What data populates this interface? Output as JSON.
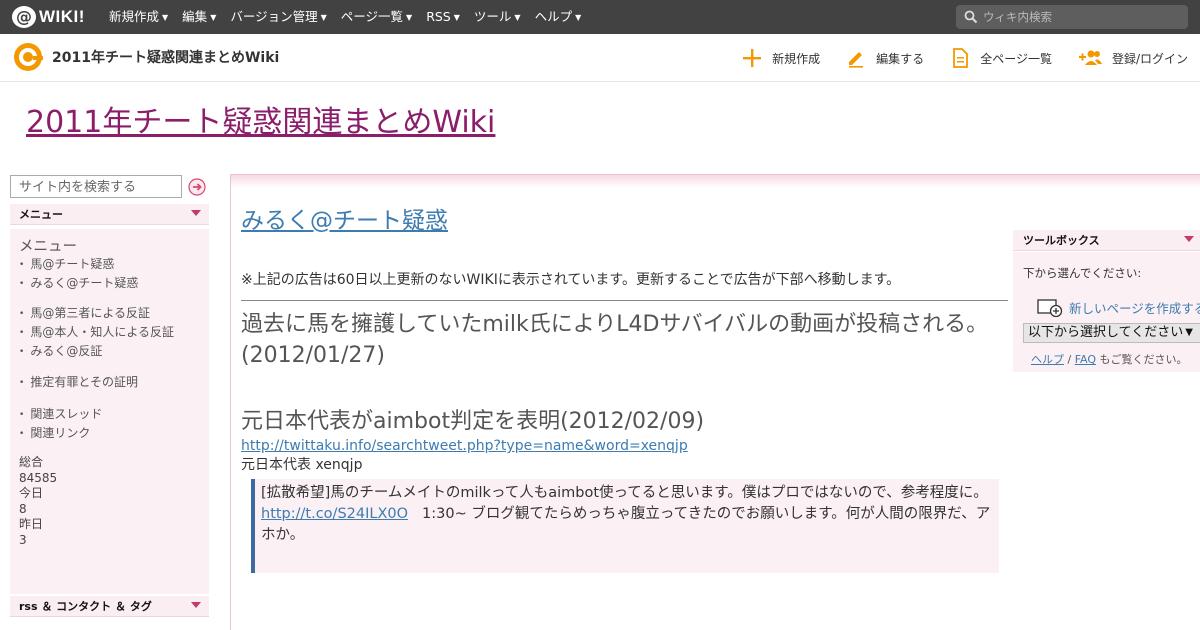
{
  "topbar": {
    "logo_at": "@",
    "logo_text": "WIKI!",
    "nav": [
      "新規作成",
      "編集",
      "バージョン管理",
      "ページ一覧",
      "RSS",
      "ツール",
      "ヘルプ"
    ],
    "search_placeholder": "ウィキ内検索"
  },
  "subbar": {
    "title": "2011年チート疑惑関連まとめWiki",
    "actions": {
      "new": "新規作成",
      "edit": "編集する",
      "all_pages": "全ページ一覧",
      "login": "登録/ログイン"
    }
  },
  "site_title": "2011年チート疑惑関連まとめWiki",
  "sidebar": {
    "search_placeholder": "サイト内を検索する",
    "menu_header": "メニュー",
    "menu_title": "メニュー",
    "groups": [
      [
        "馬@チート疑惑",
        "みるく@チート疑惑"
      ],
      [
        "馬@第三者による反証",
        "馬@本人・知人による反証",
        "みるく@反証"
      ],
      [
        "推定有罪とその証明"
      ],
      [
        "関連スレッド",
        "関連リンク"
      ]
    ],
    "counter": {
      "total_label": "総合",
      "total": "84585",
      "today_label": "今日",
      "today": "8",
      "yesterday_label": "昨日",
      "yesterday": "3"
    },
    "footer_header": "rss ＆ コンタクト ＆ タグ"
  },
  "main": {
    "page_title": "みるく@チート疑惑",
    "notice": "※上記の広告は60日以上更新のないWIKIに表示されています。更新することで広告が下部へ移動します。",
    "heading1": "過去に馬を擁護していたmilk氏によりL4Dサバイバルの動画が投稿される。(2012/01/27)",
    "heading2": "元日本代表がaimbot判定を表明(2012/02/09)",
    "link1": "http://twittaku.info/searchtweet.php?type=name&word=xenqjp",
    "plain1": "元日本代表 xenqjp",
    "quote": {
      "line1": "[拡散希望]馬のチームメイトのmilkって人もaimbot使ってると思います。僕はプロではないので、参考程度に。",
      "link": "http://t.co/S24ILX0O",
      "line2": "1:30~ ブログ観てたらめっちゃ腹立ってきたのでお願いします。何が人間の限界だ、アホか。"
    }
  },
  "toolbox": {
    "header": "ツールボックス",
    "prompt": "下から選んでください:",
    "new_page": "新しいページを作成する",
    "select_value": "以下から選択してください",
    "help_link": "ヘルプ",
    "separator": " / ",
    "faq_link": "FAQ",
    "help_suffix": " もご覧ください。"
  },
  "colors": {
    "topbar": "#424242",
    "accent_orange": "#f39800",
    "site_title": "#8b1d6b",
    "link": "#3d7bb0",
    "sidebar_bg": "#fbf1f4"
  }
}
